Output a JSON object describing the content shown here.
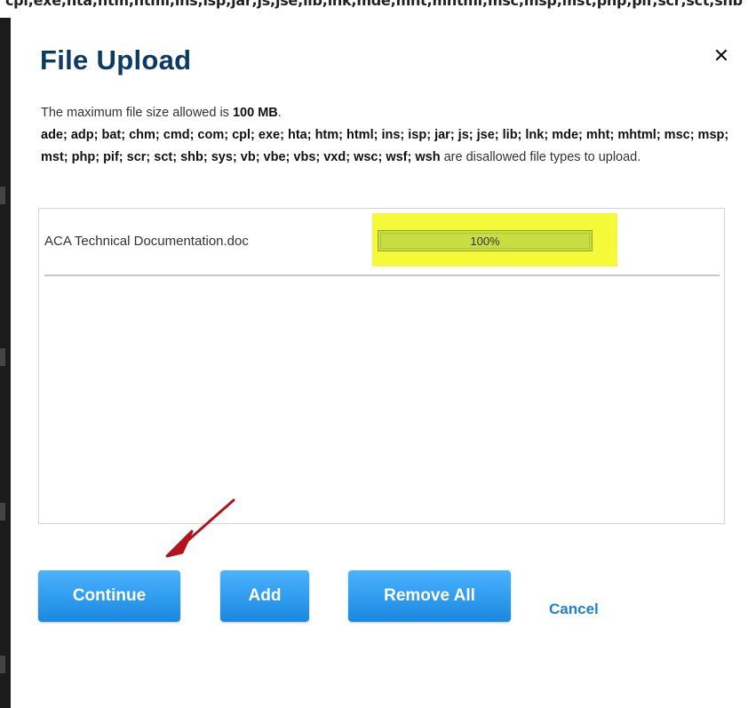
{
  "background": {
    "top_text": "cpl;exe;hta;htm;html;ins;isp;jar;js;jse;lib;lnk;mde;mht;mhtml;msc;msp;mst;php;pif;scr;sct;shb"
  },
  "dialog": {
    "title": "File Upload",
    "close_label": "✕",
    "max_size_prefix": "The maximum file size allowed is ",
    "max_size_value": "100 MB",
    "max_size_suffix": ".",
    "disallowed_types": "ade; adp; bat; chm; cmd; com; cpl; exe; hta; htm; html; ins; isp; jar; js; jse; lib; lnk; mde; mht; mhtml; msc; msp; mst; php; pif; scr; sct; shb; sys; vb; vbe; vbs; vxd; wsc; wsf; wsh",
    "disallowed_suffix": " are disallowed file types to upload."
  },
  "files": [
    {
      "name": "ACA Technical Documentation.doc",
      "progress_text": "100%",
      "progress": 1.0
    }
  ],
  "buttons": {
    "continue": "Continue",
    "add": "Add",
    "remove_all": "Remove All",
    "cancel": "Cancel"
  },
  "colors": {
    "title": "#0b3a66",
    "button": "#2196f3",
    "highlight": "#f6f93a",
    "arrow": "#b3141c"
  }
}
